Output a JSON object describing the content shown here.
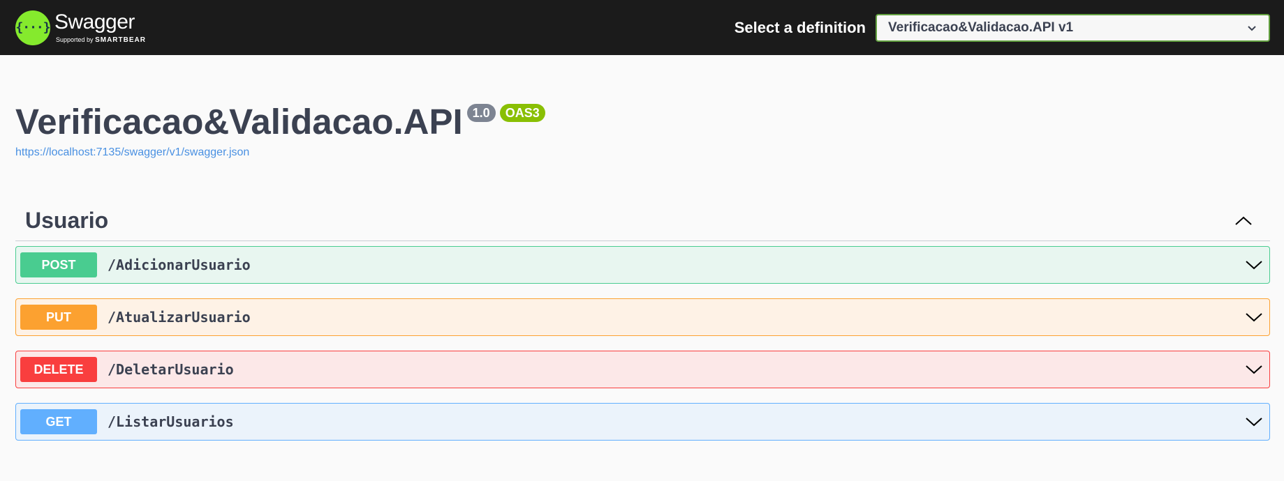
{
  "topbar": {
    "logo_symbol": "{···}",
    "logo_name": "Swagger",
    "logo_tm": ".",
    "logo_sub_prefix": "Supported by",
    "logo_sub_brand": "SMARTBEAR",
    "definition_label": "Select a definition",
    "definition_selected": "Verificacao&Validacao.API v1"
  },
  "info": {
    "title": "Verificacao&Validacao.API",
    "version": "1.0",
    "oas_badge": "OAS3",
    "spec_url": "https://localhost:7135/swagger/v1/swagger.json"
  },
  "tag": {
    "name": "Usuario",
    "expanded": true
  },
  "operations": [
    {
      "method": "POST",
      "path": "/AdicionarUsuario",
      "color": "#49cc90"
    },
    {
      "method": "PUT",
      "path": "/AtualizarUsuario",
      "color": "#fca130"
    },
    {
      "method": "DELETE",
      "path": "/DeletarUsuario",
      "color": "#f93e3e"
    },
    {
      "method": "GET",
      "path": "/ListarUsuarios",
      "color": "#61affe"
    }
  ],
  "colors": {
    "topbar_bg": "#1b1b1b",
    "swagger_green": "#85ea2d",
    "select_border": "#62a03f"
  },
  "icons": {
    "logo": "swagger-logo-icon",
    "select_arrow": "chevron-down-icon",
    "tag_toggle": "chevron-up-icon",
    "op_toggle": "chevron-down-icon"
  }
}
